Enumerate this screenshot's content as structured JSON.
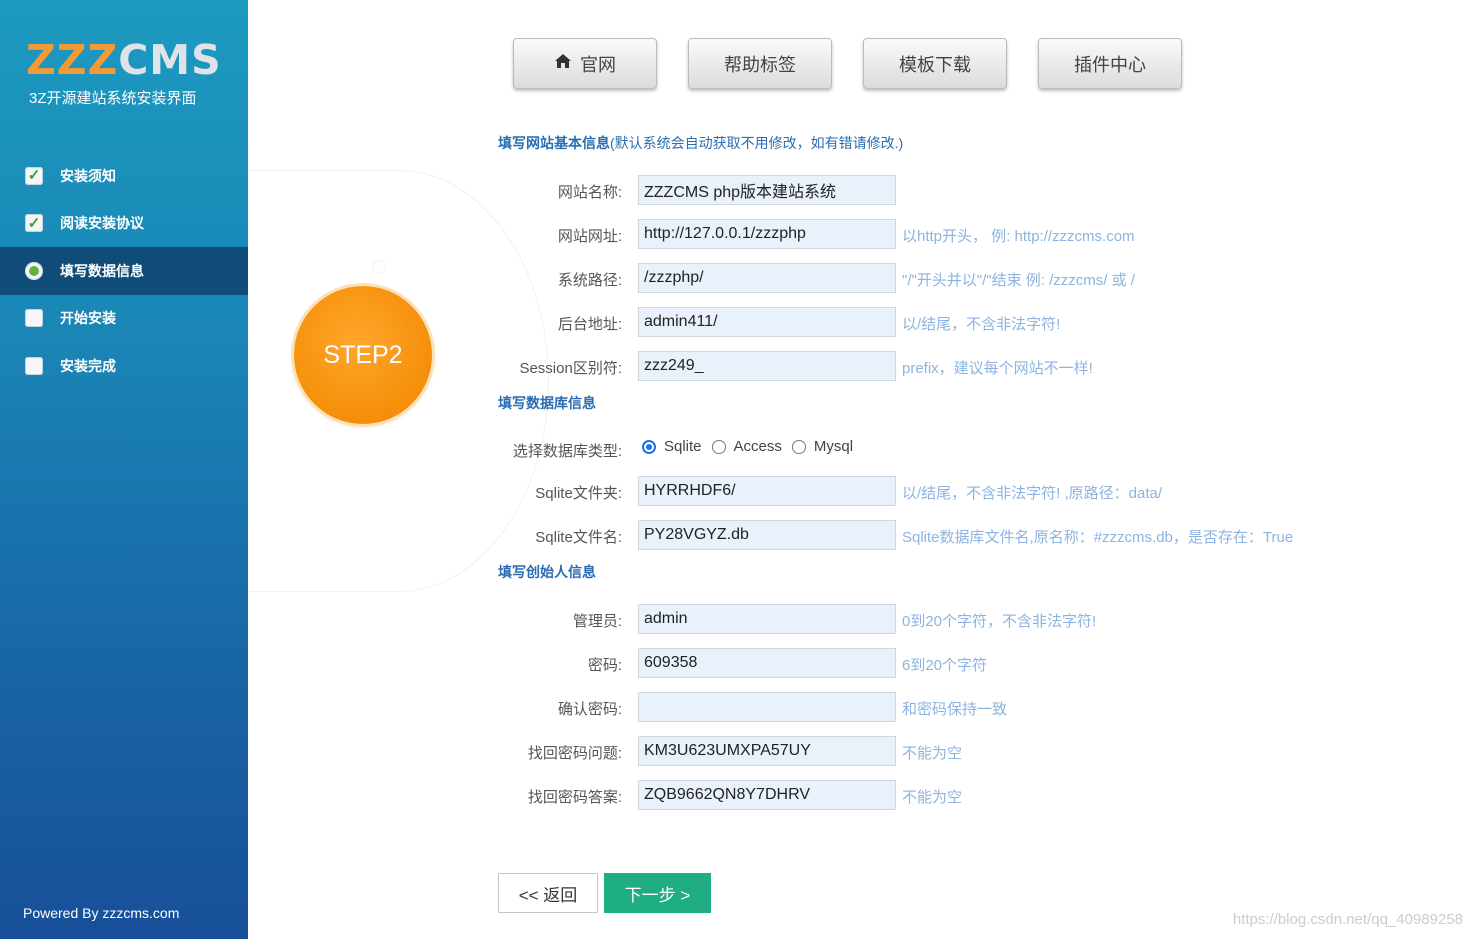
{
  "sidebar": {
    "logo_z": "ZZZ",
    "logo_c": "CMS",
    "subtitle": "3Z开源建站系统安装界面",
    "steps": [
      {
        "label": "安装须知",
        "state": "done"
      },
      {
        "label": "阅读安装协议",
        "state": "done"
      },
      {
        "label": "填写数据信息",
        "state": "current"
      },
      {
        "label": "开始安装",
        "state": "pending"
      },
      {
        "label": "安装完成",
        "state": "pending"
      }
    ],
    "powered": "Powered By zzzcms.com"
  },
  "step_badge": "STEP2",
  "topnav": [
    {
      "label": "官网",
      "icon": "home-icon"
    },
    {
      "label": "帮助标签"
    },
    {
      "label": "模板下载"
    },
    {
      "label": "插件中心"
    }
  ],
  "sections": {
    "site": {
      "title": "填写网站基本信息",
      "note": "(默认系统会自动获取不用修改，如有错请修改.)"
    },
    "db": {
      "title": "填写数据库信息"
    },
    "founder": {
      "title": "填写创始人信息"
    }
  },
  "site_fields": [
    {
      "label": "网站名称:",
      "value": "ZZZCMS php版本建站系统",
      "hint": ""
    },
    {
      "label": "网站网址:",
      "value": "http://127.0.0.1/zzzphp",
      "hint": "以http开头， 例: http://zzzcms.com"
    },
    {
      "label": "系统路径:",
      "value": "/zzzphp/",
      "hint": "\"/\"开头并以\"/\"结束 例: /zzzcms/ 或 /"
    },
    {
      "label": "后台地址:",
      "value": "admin411/",
      "hint": "以/结尾，不含非法字符!"
    },
    {
      "label": "Session区别符:",
      "value": "zzz249_",
      "hint": "prefix，建议每个网站不一样!"
    }
  ],
  "db_type": {
    "label": "选择数据库类型:",
    "options": [
      "Sqlite",
      "Access",
      "Mysql"
    ],
    "selected": "Sqlite"
  },
  "db_fields": [
    {
      "label": "Sqlite文件夹:",
      "value": "HYRRHDF6/",
      "hint": "以/结尾，不含非法字符! ,原路径：data/"
    },
    {
      "label": "Sqlite文件名:",
      "value": "PY28VGYZ.db",
      "hint": "Sqlite数据库文件名,原名称：#zzzcms.db，是否存在：True"
    }
  ],
  "founder_fields": [
    {
      "label": "管理员:",
      "value": "admin",
      "hint": "0到20个字符，不含非法字符!"
    },
    {
      "label": "密码:",
      "value": "609358",
      "hint": "6到20个字符"
    },
    {
      "label": "确认密码:",
      "value": "",
      "hint": "和密码保持一致"
    },
    {
      "label": "找回密码问题:",
      "value": "KM3U623UMXPA57UY",
      "hint": "不能为空"
    },
    {
      "label": "找回密码答案:",
      "value": "ZQB9662QN8Y7DHRV",
      "hint": "不能为空"
    }
  ],
  "buttons": {
    "back": "<< 返回",
    "next": "下一步 >"
  },
  "watermark": "https://blog.csdn.net/qq_40989258",
  "colors": {
    "accent_orange": "#f6920e",
    "sidebar_blue": "#1a86b6",
    "next_green": "#1fae83",
    "section_blue": "#2a6db3",
    "hint_blue": "#8db3e0"
  }
}
